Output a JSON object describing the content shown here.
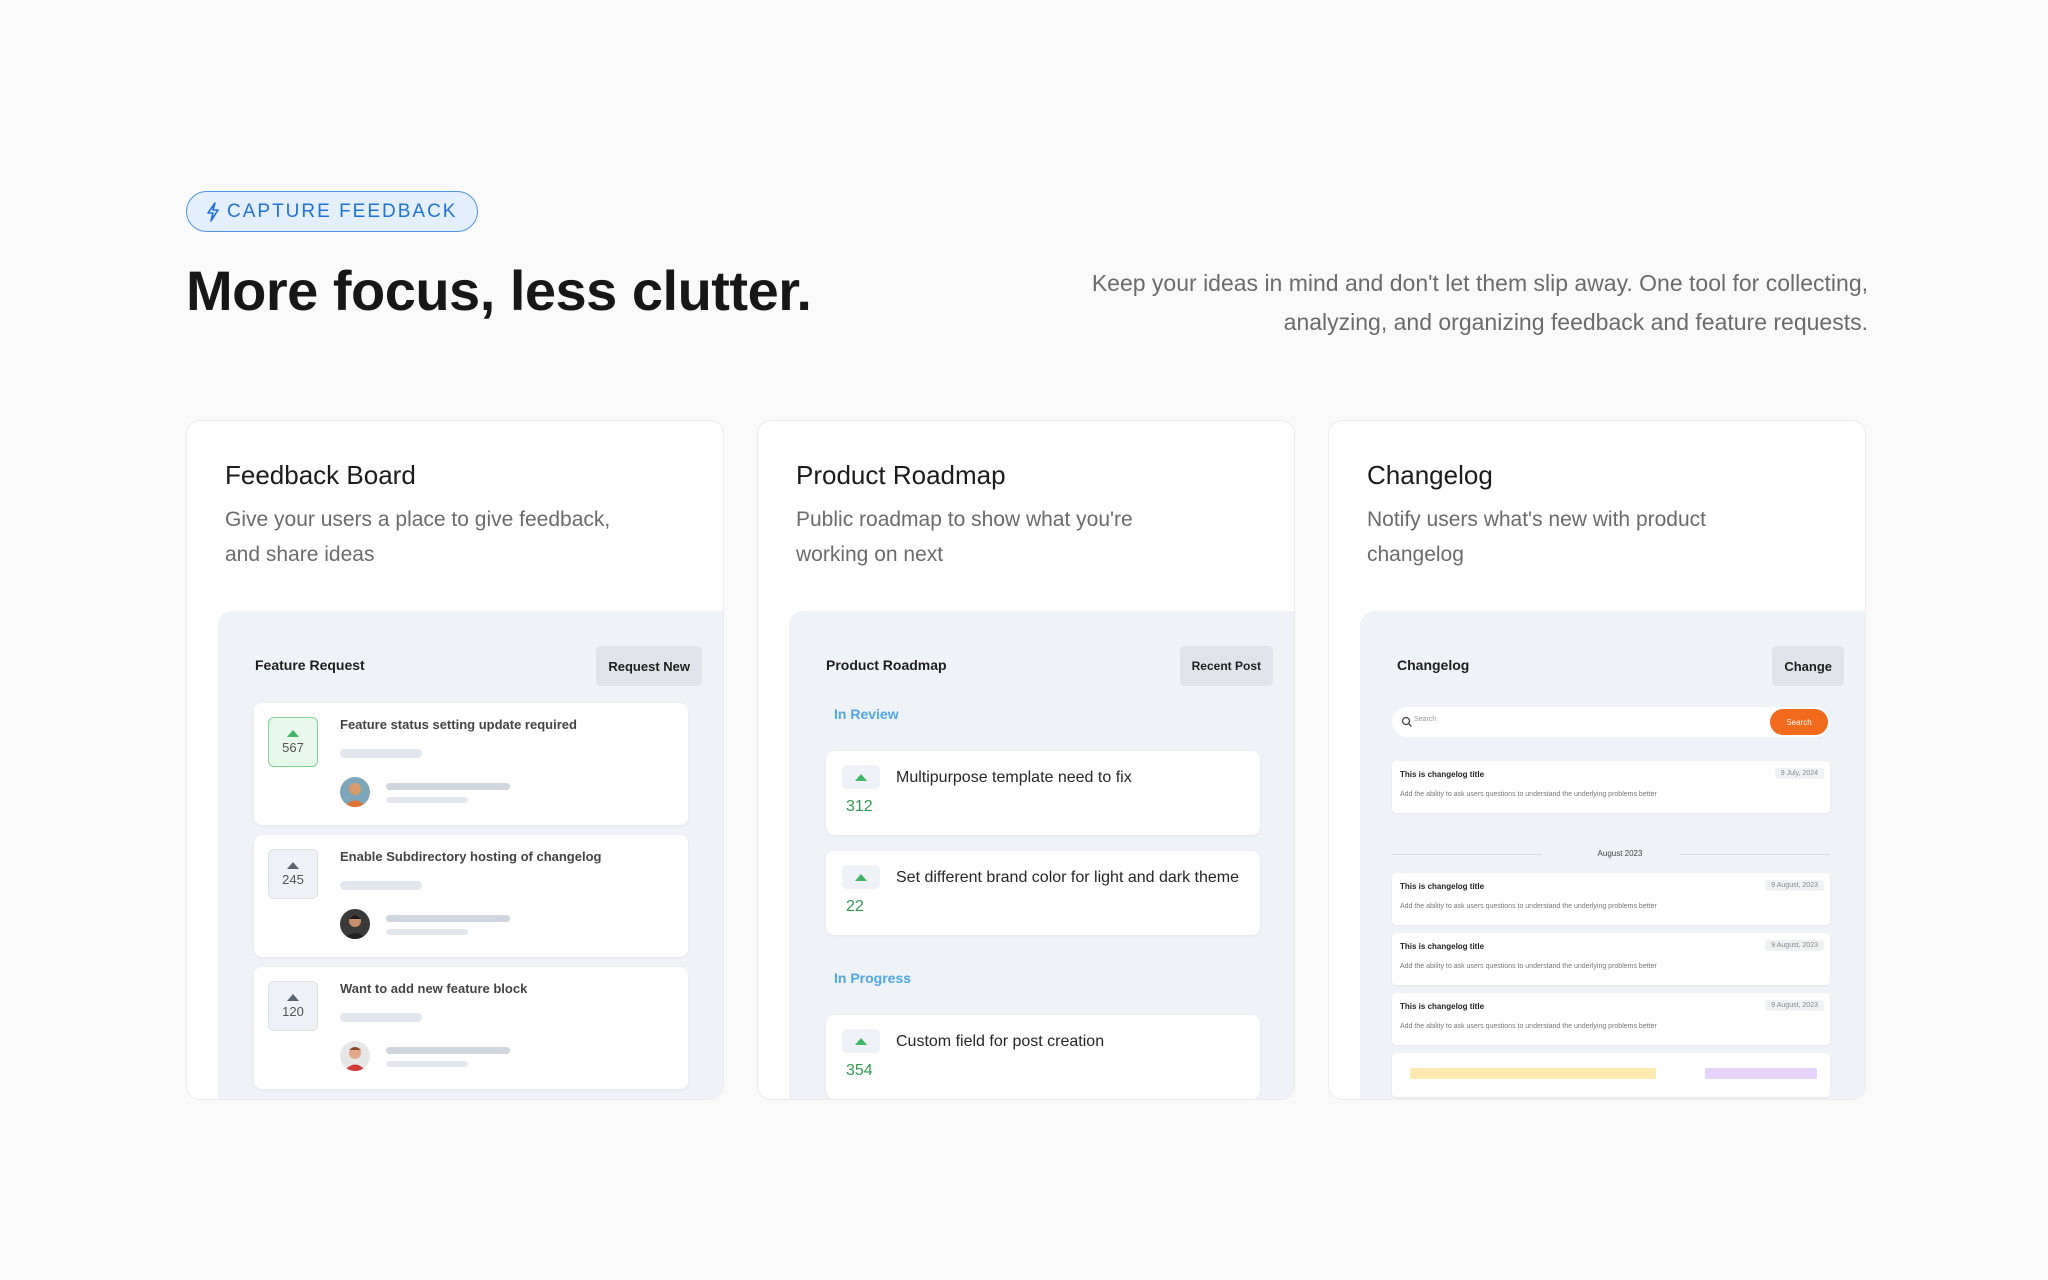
{
  "badge": {
    "label": "CAPTURE FEEDBACK",
    "icon": "lightning-icon",
    "color": "#1f73d6"
  },
  "headline": "More focus, less clutter.",
  "subtext": "Keep your ideas in mind and don't let them slip away. One tool for collecting, analyzing, and organizing feedback and feature requests.",
  "cards": [
    {
      "title": "Feedback Board",
      "description": "Give your users a place to give feedback, and share ideas",
      "preview": {
        "title": "Feature Request",
        "button": "Request New",
        "items": [
          {
            "votes": "567",
            "text": "Feature status setting update required",
            "active": true
          },
          {
            "votes": "245",
            "text": "Enable Subdirectory hosting of changelog",
            "active": false
          },
          {
            "votes": "120",
            "text": "Want to add new feature block",
            "active": false
          }
        ]
      }
    },
    {
      "title": "Product Roadmap",
      "description": "Public roadmap to show what you're working on next",
      "preview": {
        "title": "Product Roadmap",
        "button": "Recent Post",
        "sections": [
          {
            "label": "In Review",
            "items": [
              {
                "votes": "312",
                "text": "Multipurpose template need to fix"
              },
              {
                "votes": "22",
                "text": "Set different brand color for light and dark theme"
              }
            ]
          },
          {
            "label": "In Progress",
            "items": [
              {
                "votes": "354",
                "text": "Custom field for post creation"
              }
            ]
          }
        ]
      }
    },
    {
      "title": "Changelog",
      "description": "Notify users what's new with product changelog",
      "preview": {
        "title": "Changelog",
        "button": "Change",
        "search_placeholder": "Search",
        "search_button": "Search",
        "month": "August 2023",
        "entries": [
          {
            "title": "This is changelog title",
            "desc": "Add the ability to ask users questions to understand the underlying problems better",
            "date": "9 July, 2024"
          },
          {
            "title": "This is changelog title",
            "desc": "Add the ability to ask users questions to understand the underlying problems better",
            "date": "9 August, 2023"
          },
          {
            "title": "This is changelog title",
            "desc": "Add the ability to ask users questions to understand the underlying problems better",
            "date": "9 August, 2023"
          },
          {
            "title": "This is changelog title",
            "desc": "Add the ability to ask users questions to understand the underlying problems better",
            "date": "9 August, 2023"
          }
        ]
      }
    }
  ]
}
